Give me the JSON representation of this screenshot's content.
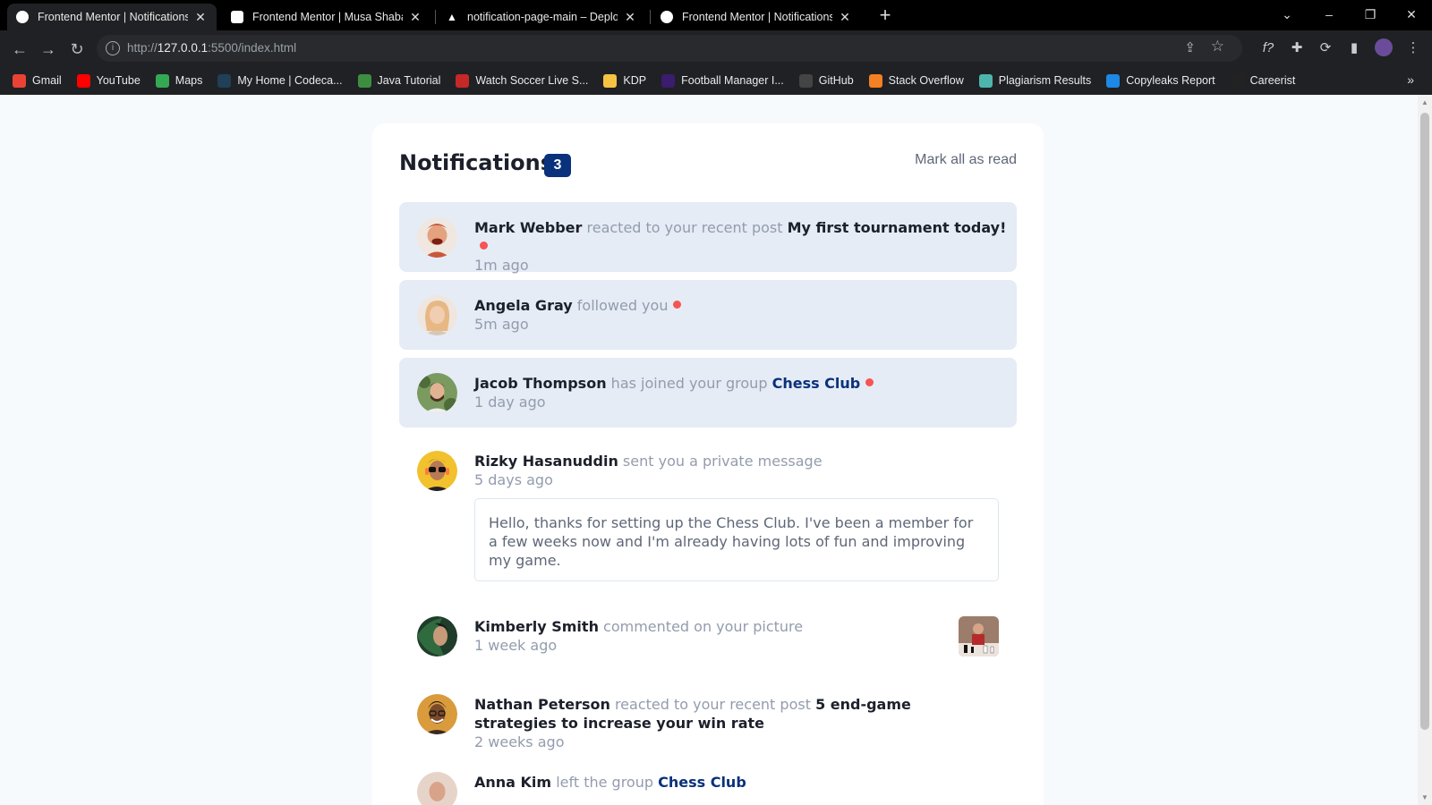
{
  "browser": {
    "tabs": [
      {
        "title": "Frontend Mentor | Notifications p",
        "active": true
      },
      {
        "title": "Frontend Mentor | Musa Shaba's",
        "active": false
      },
      {
        "title": "notification-page-main – Deploy",
        "active": false
      },
      {
        "title": "Frontend Mentor | Notifications p",
        "active": false
      }
    ],
    "url_prefix": "http://",
    "url_host": "127.0.0.1",
    "url_rest": ":5500/index.html",
    "bookmarks": [
      {
        "label": "Gmail",
        "icon": "gmail-icon",
        "color": "#ea4335"
      },
      {
        "label": "YouTube",
        "icon": "youtube-icon",
        "color": "#ff0000"
      },
      {
        "label": "Maps",
        "icon": "maps-icon",
        "color": "#34a853"
      },
      {
        "label": "My Home | Codeca...",
        "icon": "codecademy-icon",
        "color": "#1f4056"
      },
      {
        "label": "Java Tutorial",
        "icon": "java-icon",
        "color": "#3e8e41"
      },
      {
        "label": "Watch Soccer Live S...",
        "icon": "soccer-icon",
        "color": "#c62828"
      },
      {
        "label": "KDP",
        "icon": "folder-icon",
        "color": "#f6c343"
      },
      {
        "label": "Football Manager I...",
        "icon": "fm-icon",
        "color": "#3b1c6e"
      },
      {
        "label": "GitHub",
        "icon": "github-icon",
        "color": "#444"
      },
      {
        "label": "Stack Overflow",
        "icon": "stackoverflow-icon",
        "color": "#f48024"
      },
      {
        "label": "Plagiarism Results",
        "icon": "plagiarism-icon",
        "color": "#4db6ac"
      },
      {
        "label": "Copyleaks Report",
        "icon": "copyleaks-icon",
        "color": "#1e88e5"
      },
      {
        "label": "Careerist",
        "icon": "careerist-icon",
        "color": "#222"
      }
    ]
  },
  "page": {
    "title": "Notifications",
    "unread_count": "3",
    "mark_all_label": "Mark all as read",
    "notifications": [
      {
        "name": "Mark Webber",
        "action": "reacted to your recent post",
        "target": "My first tournament today!",
        "target_type": "post",
        "time": "1m ago",
        "unread": true,
        "avatar_color": "#c9573a"
      },
      {
        "name": "Angela Gray",
        "action": "followed you",
        "target": "",
        "time": "5m ago",
        "unread": true,
        "avatar_color": "#e2b58a"
      },
      {
        "name": "Jacob Thompson",
        "action": "has joined your group",
        "target": "Chess Club",
        "target_type": "group",
        "time": "1 day ago",
        "unread": true,
        "avatar_color": "#5a7d4a"
      },
      {
        "name": "Rizky Hasanuddin",
        "action": "sent you a private message",
        "target": "",
        "time": "5 days ago",
        "unread": false,
        "avatar_color": "#f2c12e",
        "message": "Hello, thanks for setting up the Chess Club. I've been a member for a few weeks now and I'm already having lots of fun and improving my game."
      },
      {
        "name": "Kimberly Smith",
        "action": "commented on your picture",
        "target": "",
        "time": "1 week ago",
        "unread": false,
        "avatar_color": "#2f6b3f"
      },
      {
        "name": "Nathan Peterson",
        "action": "reacted to your recent post",
        "target": "5 end-game strategies to increase your win rate",
        "target_type": "post",
        "time": "2 weeks ago",
        "unread": false,
        "avatar_color": "#8a5a2b"
      },
      {
        "name": "Anna Kim",
        "action": "left the group",
        "target": "Chess Club",
        "target_type": "group",
        "time": "",
        "unread": false,
        "avatar_color": "#d9a38a"
      }
    ]
  }
}
